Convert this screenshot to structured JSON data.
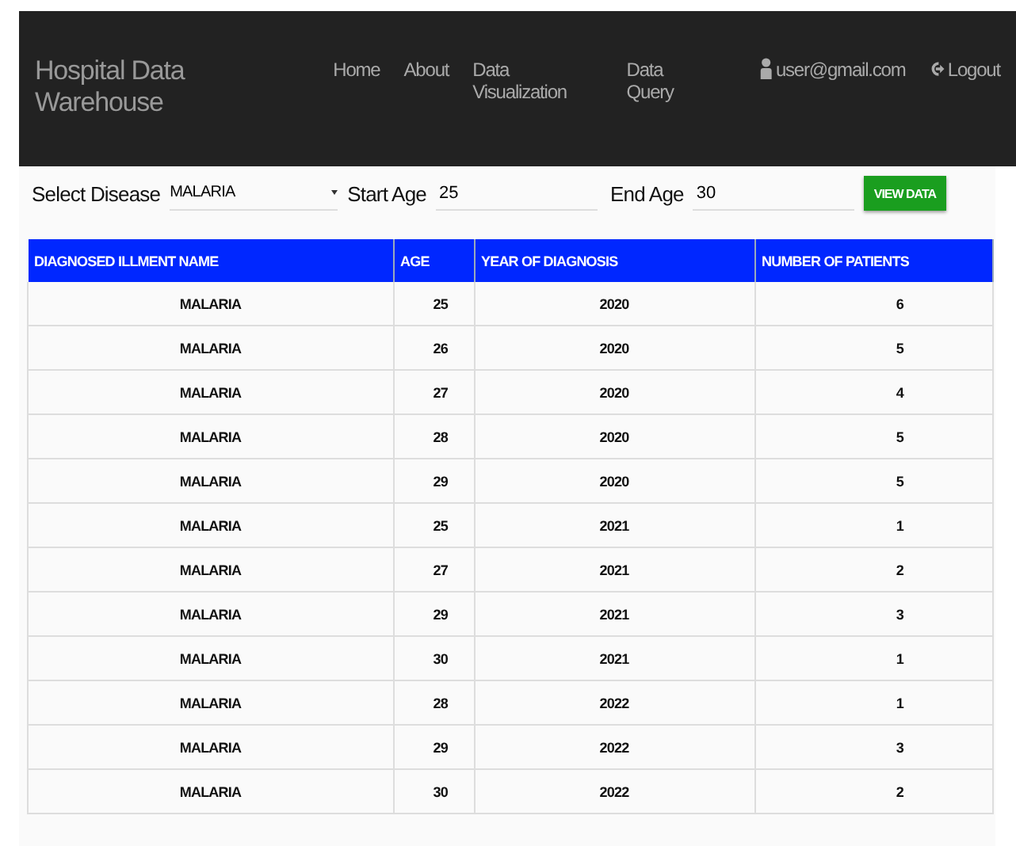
{
  "navbar": {
    "brand": "Hospital Data Warehouse",
    "links": [
      {
        "label": "Home"
      },
      {
        "label": "About"
      },
      {
        "label": "Data Visualization"
      },
      {
        "label": "Data Query"
      }
    ],
    "user": "user@gmail.com",
    "logout": "Logout"
  },
  "filters": {
    "disease_label": "Select Disease",
    "disease": "MALARIA",
    "start_label": "Start Age",
    "start_age": "25",
    "end_label": "End Age",
    "end_age": "30",
    "button": "VIEW DATA"
  },
  "table": {
    "columns": [
      "DIAGNOSED ILLMENT NAME",
      "AGE",
      "YEAR OF DIAGNOSIS",
      "NUMBER OF PATIENTS"
    ],
    "rows": [
      [
        "MALARIA",
        "25",
        "2020",
        "6"
      ],
      [
        "MALARIA",
        "26",
        "2020",
        "5"
      ],
      [
        "MALARIA",
        "27",
        "2020",
        "4"
      ],
      [
        "MALARIA",
        "28",
        "2020",
        "5"
      ],
      [
        "MALARIA",
        "29",
        "2020",
        "5"
      ],
      [
        "MALARIA",
        "25",
        "2021",
        "1"
      ],
      [
        "MALARIA",
        "27",
        "2021",
        "2"
      ],
      [
        "MALARIA",
        "29",
        "2021",
        "3"
      ],
      [
        "MALARIA",
        "30",
        "2021",
        "1"
      ],
      [
        "MALARIA",
        "28",
        "2022",
        "1"
      ],
      [
        "MALARIA",
        "29",
        "2022",
        "3"
      ],
      [
        "MALARIA",
        "30",
        "2022",
        "2"
      ]
    ]
  }
}
